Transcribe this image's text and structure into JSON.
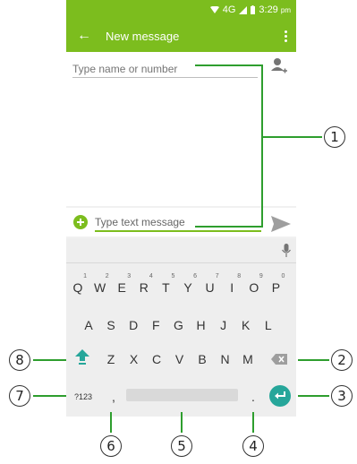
{
  "status_bar": {
    "network": "4G",
    "time": "3:29",
    "ampm": "pm"
  },
  "app_bar": {
    "title": "New message"
  },
  "compose": {
    "to_placeholder": "Type name or number",
    "message_placeholder": "Type text message"
  },
  "keyboard": {
    "row1": [
      "Q",
      "W",
      "E",
      "R",
      "T",
      "Y",
      "U",
      "I",
      "O",
      "P"
    ],
    "row1_hints": [
      "1",
      "2",
      "3",
      "4",
      "5",
      "6",
      "7",
      "8",
      "9",
      "0"
    ],
    "row2": [
      "A",
      "S",
      "D",
      "F",
      "G",
      "H",
      "J",
      "K",
      "L"
    ],
    "row3": [
      "Z",
      "X",
      "C",
      "V",
      "B",
      "N",
      "M"
    ],
    "symbols_key": "?123",
    "comma_key": ",",
    "period_key": "."
  },
  "callouts": [
    "1",
    "2",
    "3",
    "4",
    "5",
    "6",
    "7",
    "8"
  ],
  "colors": {
    "accent": "#7cbd1e",
    "enter": "#26a69a",
    "callout": "#2e9e2e"
  }
}
